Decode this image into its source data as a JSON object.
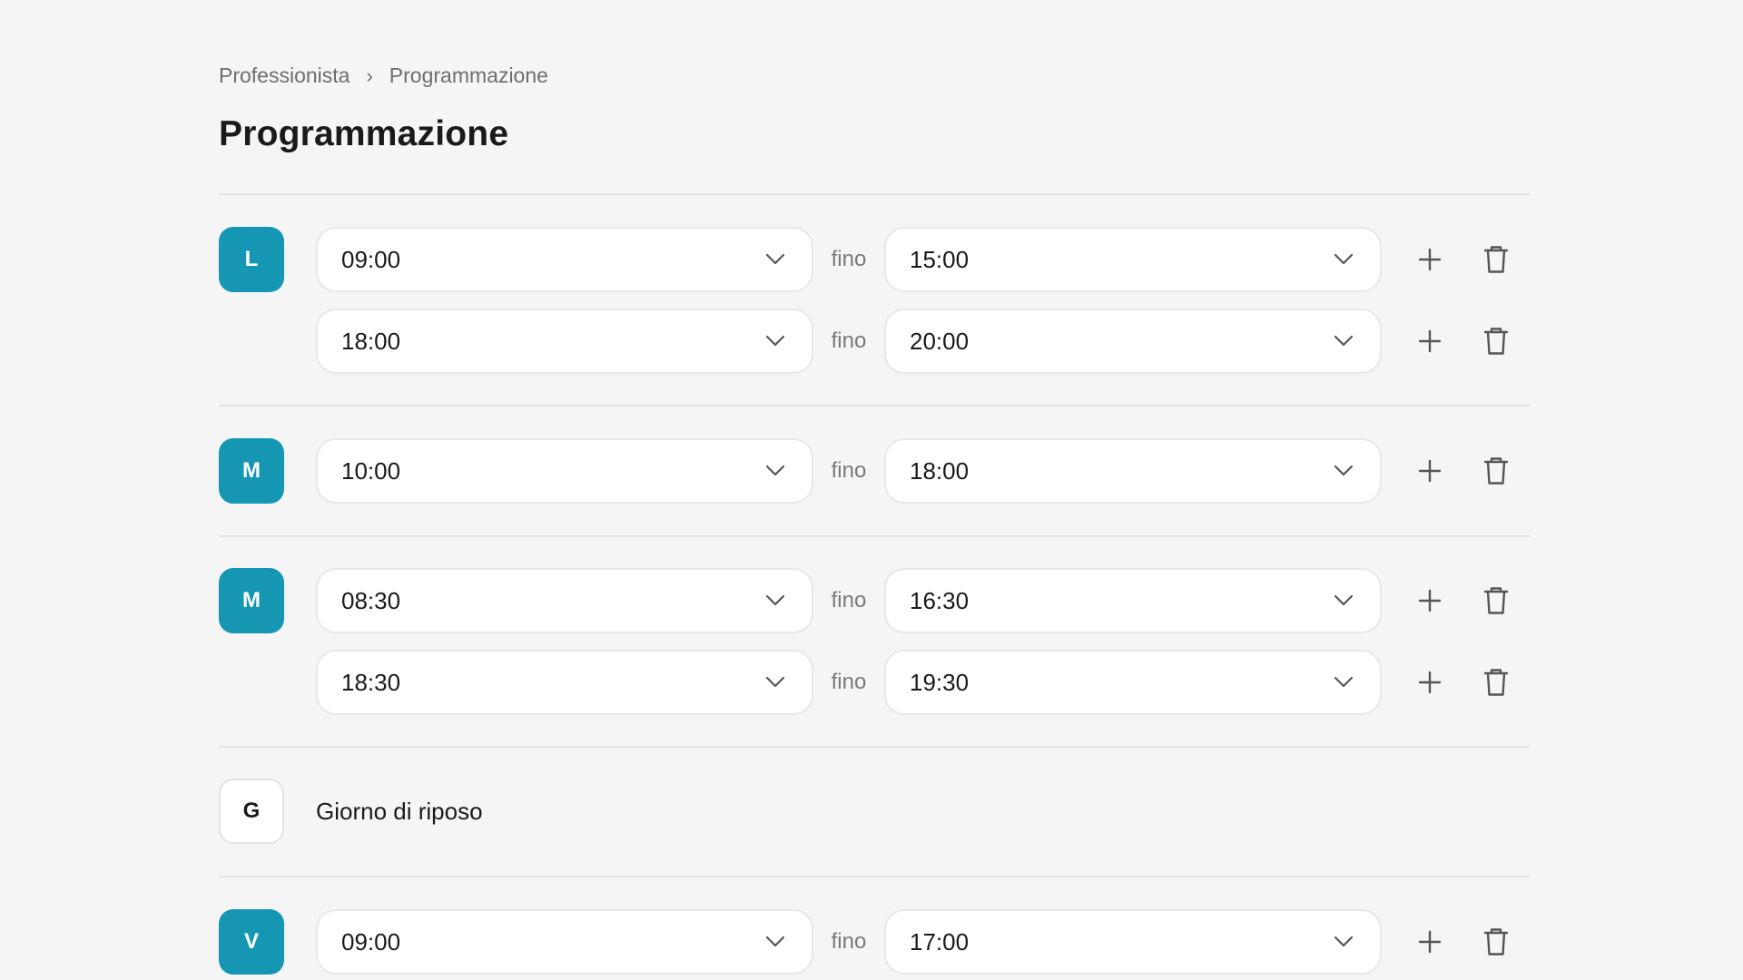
{
  "breadcrumb": {
    "items": [
      "Professionista",
      "Programmazione"
    ],
    "separator": "›"
  },
  "page": {
    "title": "Programmazione"
  },
  "schedule": {
    "connector": "fino",
    "rest_label": "Giorno di riposo",
    "days": [
      {
        "letter": "L",
        "active": true,
        "slots": [
          {
            "from": "09:00",
            "to": "15:00"
          },
          {
            "from": "18:00",
            "to": "20:00"
          }
        ]
      },
      {
        "letter": "M",
        "active": true,
        "slots": [
          {
            "from": "10:00",
            "to": "18:00"
          }
        ]
      },
      {
        "letter": "M",
        "active": true,
        "slots": [
          {
            "from": "08:30",
            "to": "16:30"
          },
          {
            "from": "18:30",
            "to": "19:30"
          }
        ]
      },
      {
        "letter": "G",
        "active": false,
        "slots": []
      },
      {
        "letter": "V",
        "active": true,
        "slots": [
          {
            "from": "09:00",
            "to": "17:00"
          }
        ]
      }
    ]
  },
  "icons": {
    "dropdown": "chevron-down-icon",
    "add": "plus-icon",
    "delete": "trash-icon"
  },
  "colors": {
    "background": "#f5f5f5",
    "accent": "#1597b4",
    "divider": "#e2e2e2",
    "icon": "#555555"
  }
}
